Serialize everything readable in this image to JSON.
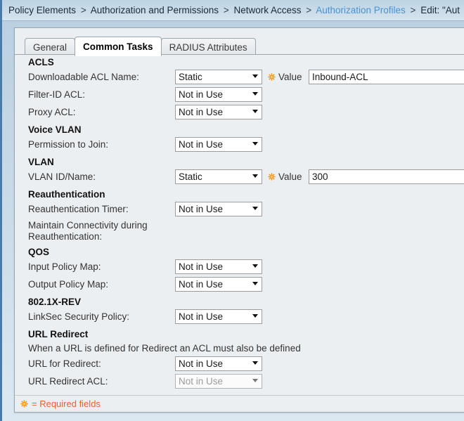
{
  "breadcrumb": {
    "items": [
      {
        "text": "Policy Elements",
        "link": false
      },
      {
        "text": "Authorization and Permissions",
        "link": false
      },
      {
        "text": "Network Access",
        "link": false
      },
      {
        "text": "Authorization Profiles",
        "link": true
      },
      {
        "text": "Edit: \"Aut",
        "link": false
      }
    ],
    "separator": ">"
  },
  "tabs": [
    {
      "label": "General",
      "active": false
    },
    {
      "label": "Common Tasks",
      "active": true
    },
    {
      "label": "RADIUS Attributes",
      "active": false
    }
  ],
  "sections": {
    "acls": {
      "heading": "ACLS",
      "downloadable_acl_name": {
        "label": "Downloadable ACL Name:",
        "select_value": "Static",
        "value_label": "Value",
        "value_field": "Inbound-ACL"
      },
      "filter_id_acl": {
        "label": "Filter-ID ACL:",
        "select_value": "Not in Use"
      },
      "proxy_acl": {
        "label": "Proxy ACL:",
        "select_value": "Not in Use"
      }
    },
    "voice_vlan": {
      "heading": "Voice VLAN",
      "permission_to_join": {
        "label": "Permission to Join:",
        "select_value": "Not in Use"
      }
    },
    "vlan": {
      "heading": "VLAN",
      "vlan_id_name": {
        "label": "VLAN ID/Name:",
        "select_value": "Static",
        "value_label": "Value",
        "value_field": "300"
      }
    },
    "reauthentication": {
      "heading": "Reauthentication",
      "reauth_timer": {
        "label": "Reauthentication Timer:",
        "select_value": "Not in Use"
      },
      "maintain_connectivity": {
        "label": "Maintain Connectivity during Reauthentication:"
      }
    },
    "qos": {
      "heading": "QOS",
      "input_policy_map": {
        "label": "Input Policy Map:",
        "select_value": "Not in Use"
      },
      "output_policy_map": {
        "label": "Output Policy Map:",
        "select_value": "Not in Use"
      }
    },
    "dot1x_rev": {
      "heading": "802.1X-REV",
      "linksec_security_policy": {
        "label": "LinkSec Security Policy:",
        "select_value": "Not in Use"
      }
    },
    "url_redirect": {
      "heading": "URL Redirect",
      "note": "When a URL is defined for Redirect an ACL must also be defined",
      "url_for_redirect": {
        "label": "URL for Redirect:",
        "select_value": "Not in Use"
      },
      "url_redirect_acl": {
        "label": "URL Redirect ACL:",
        "select_value": "Not in Use"
      }
    }
  },
  "footer": {
    "required_fields_text": "= Required fields"
  },
  "colors": {
    "required_orange": "#e8622c",
    "gear_orange": "#f7941d",
    "link_blue": "#4b93d1",
    "panel_bg": "#eceff1",
    "frame_blue": "#4a7ba8"
  }
}
